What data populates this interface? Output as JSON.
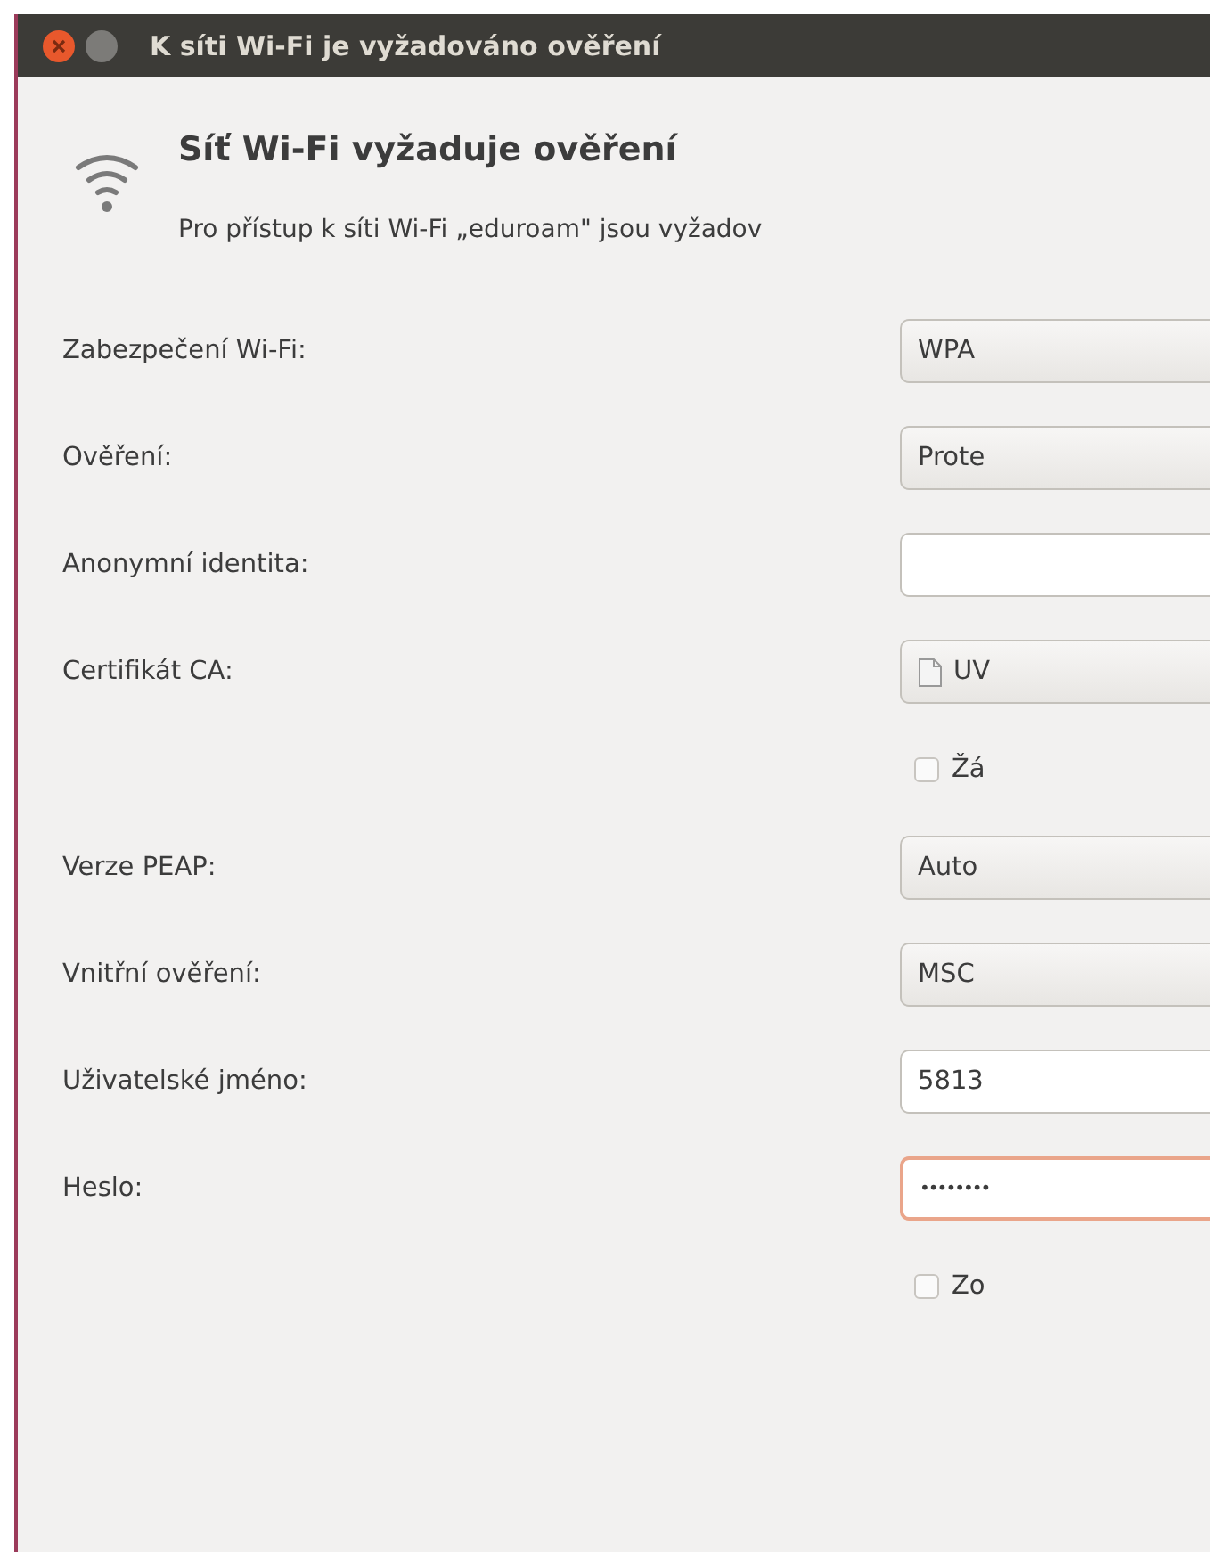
{
  "window": {
    "title": "K síti Wi-Fi je vyžadováno ověření"
  },
  "heading": "Síť Wi-Fi vyžaduje ověření",
  "description": "Pro přístup k síti Wi-Fi „eduroam\" jsou vyžadov",
  "rows": [
    {
      "kind": "combo",
      "label": "Zabezpečení Wi-Fi:",
      "value": "WPA"
    },
    {
      "kind": "combo",
      "label": "Ověření:",
      "value": "Prote"
    },
    {
      "kind": "entry",
      "label": "Anonymní identita:",
      "value": ""
    },
    {
      "kind": "file",
      "label": "Certifikát CA:",
      "value": "UV"
    },
    {
      "kind": "checkbox",
      "text": "Žá",
      "checked": false
    },
    {
      "kind": "combo",
      "label": "Verze PEAP:",
      "value": "Auto"
    },
    {
      "kind": "combo",
      "label": "Vnitřní ověření:",
      "value": "MSC"
    },
    {
      "kind": "entry",
      "label": "Uživatelské jméno:",
      "value": "5813"
    },
    {
      "kind": "password",
      "label": "Heslo:",
      "value": "••••••••"
    },
    {
      "kind": "checkbox",
      "text": "Zo",
      "checked": false
    }
  ]
}
